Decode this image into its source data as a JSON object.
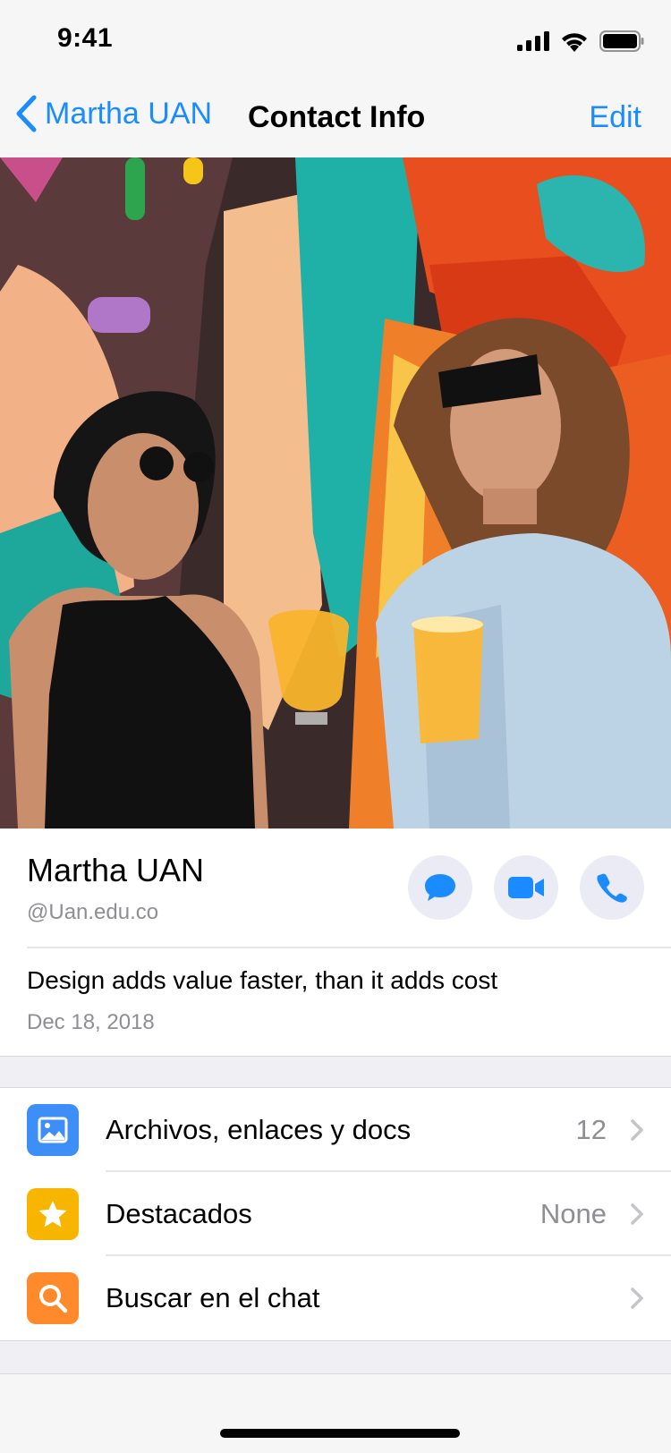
{
  "status_bar": {
    "time": "9:41"
  },
  "nav": {
    "back_label": "Martha UAN",
    "title": "Contact Info",
    "edit_label": "Edit"
  },
  "profile": {
    "name": "Martha UAN",
    "handle": "@Uan.edu.co",
    "status": "Design adds value faster, than it adds cost",
    "status_date": "Dec 18, 2018"
  },
  "actions": [
    {
      "icon": "message-icon"
    },
    {
      "icon": "video-icon"
    },
    {
      "icon": "phone-icon"
    }
  ],
  "list": {
    "items": [
      {
        "label": "Archivos, enlaces y docs",
        "value": "12",
        "icon": "photo-icon",
        "color": "#3d8ef7"
      },
      {
        "label": "Destacados",
        "value": "None",
        "icon": "star-icon",
        "color": "#f7b500"
      },
      {
        "label": "Buscar en el chat",
        "value": "",
        "icon": "search-icon",
        "color": "#ff8a2b"
      }
    ]
  },
  "colors": {
    "accent": "#1a8cff",
    "secondary_text": "#8e8e93",
    "action_bg": "#ebebf5"
  }
}
